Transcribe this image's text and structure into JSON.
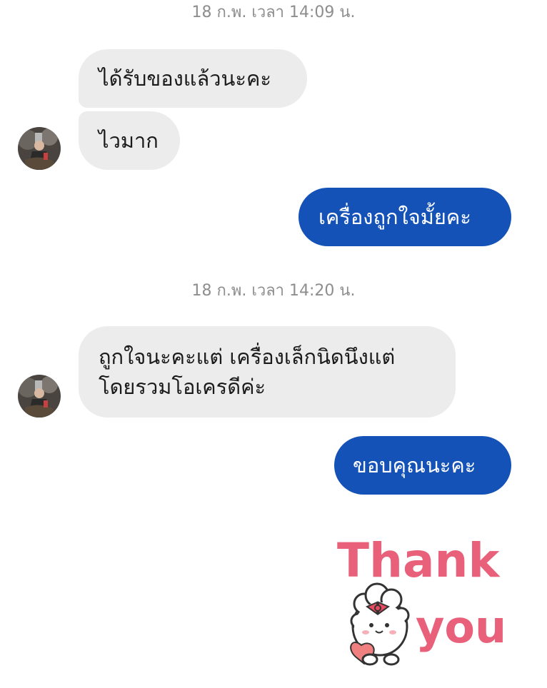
{
  "conversation": {
    "timestamp_1": "18 ก.พ. เวลา 14:09 น.",
    "timestamp_2": "18 ก.พ. เวลา 14:20 น.",
    "messages": [
      {
        "sender": "contact",
        "text": "ได้รับของแล้วนะคะ"
      },
      {
        "sender": "contact",
        "text": "ไวมาก"
      },
      {
        "sender": "me",
        "text": "เครื่องถูกใจมั้ยคะ"
      },
      {
        "sender": "contact",
        "lines": [
          "ถูกใจนะคะแต่ เครื่องเล็กนิดนึงแต่",
          "โดยรวมโอเครดีค่ะ"
        ]
      },
      {
        "sender": "me",
        "text": "ขอบคุณนะคะ"
      }
    ],
    "sticker": {
      "icon": "thank-you-bunny-sticker",
      "words": [
        "Thank",
        "you"
      ],
      "colors": {
        "text": "#e8607a",
        "outline": "#ffffff",
        "bow": "#e84a5f",
        "heart": "#f08080"
      }
    }
  },
  "theme": {
    "outgoing_bubble": "#1452b8",
    "incoming_bubble": "#ececec",
    "timestamp_color": "#8e8e8e"
  }
}
